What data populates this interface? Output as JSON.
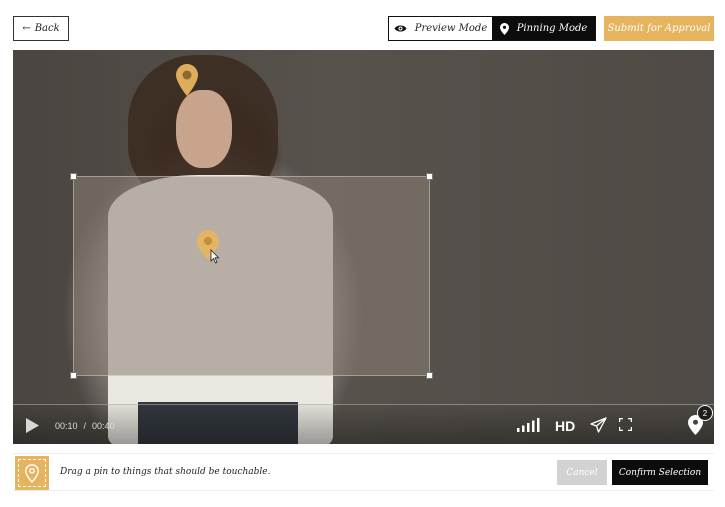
{
  "header": {
    "back_arrow": "←",
    "back_label": "Back",
    "preview_mode_label": "Preview Mode",
    "pinning_mode_label": "Pinning Mode",
    "submit_label": "Submit for Approval"
  },
  "player": {
    "current_time": "00:10",
    "separator": "/",
    "duration": "00:40",
    "quality_label": "HD",
    "pin_count": "2"
  },
  "footer": {
    "instruction": "Drag a pin to things that should be touchable.",
    "cancel_label": "Cancel",
    "confirm_label": "Confirm Selection"
  },
  "colors": {
    "accent": "#e6b45e",
    "dark": "#0c0c0c",
    "disabled": "#d2d2d2"
  },
  "icons": {
    "back": "arrow-left-icon",
    "preview": "eye-icon",
    "pinning": "map-pin-icon",
    "play": "play-icon",
    "signal": "signal-bars-icon",
    "share": "paper-plane-icon",
    "fullscreen": "fullscreen-icon",
    "pin_count": "map-pin-icon"
  }
}
